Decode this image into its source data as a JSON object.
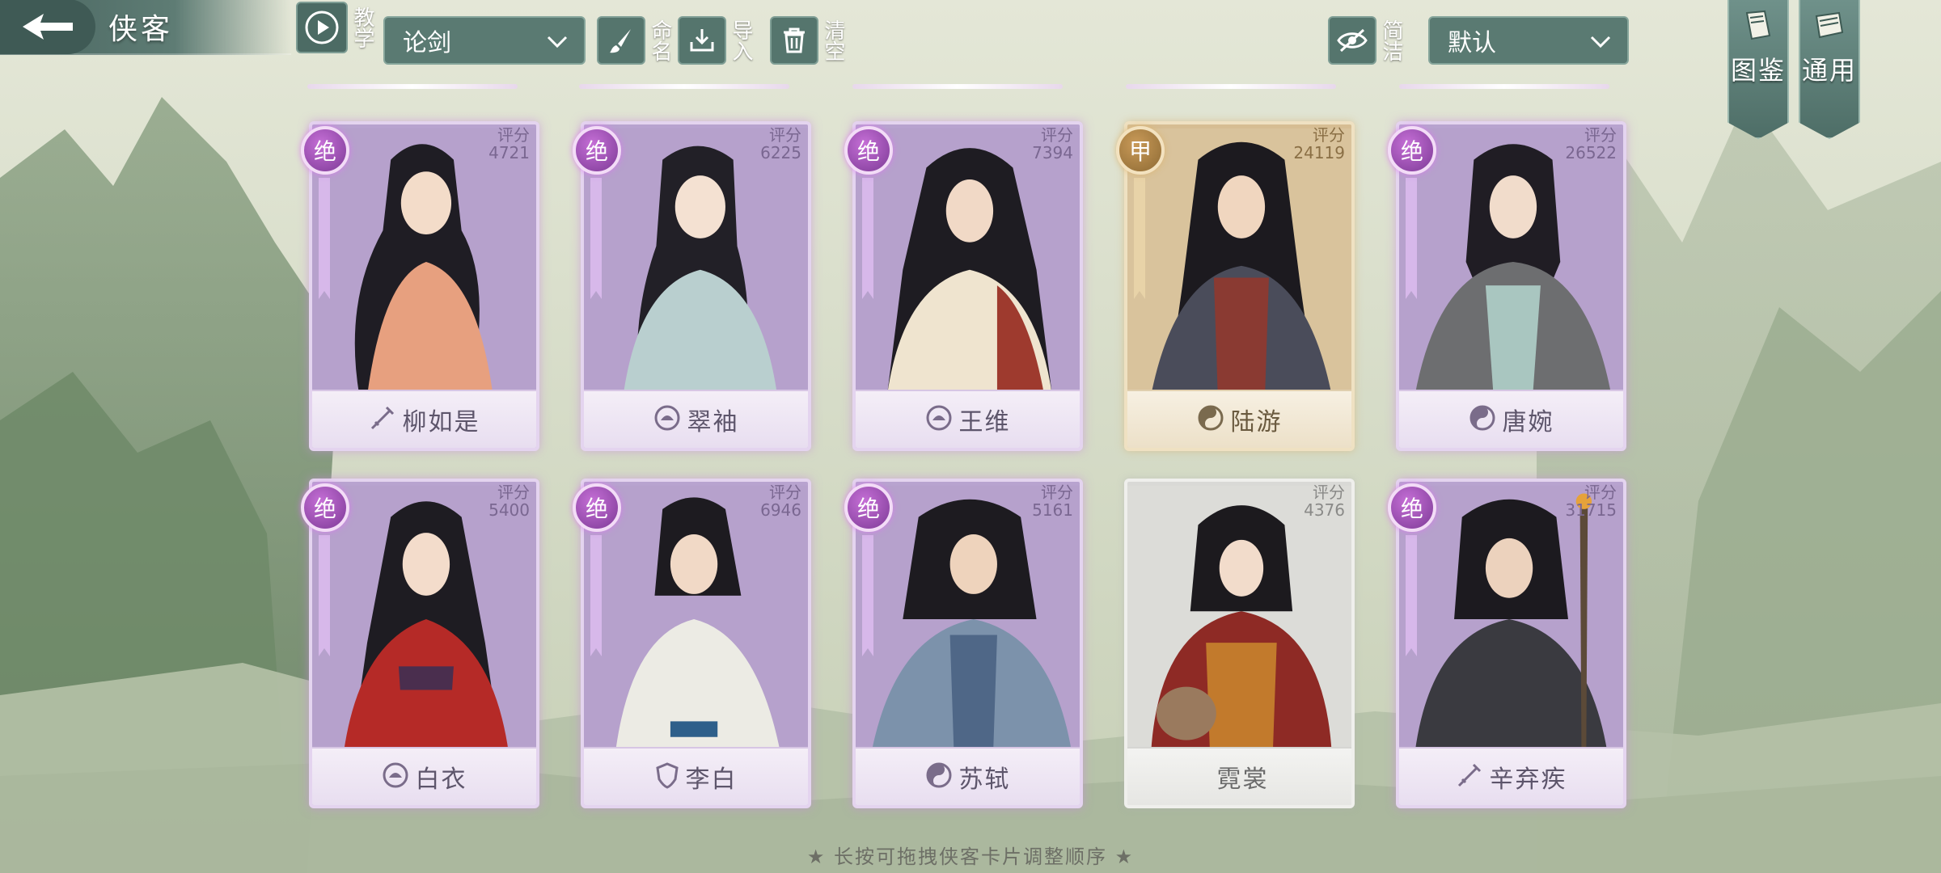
{
  "header": {
    "title": "侠客",
    "teach_label": "教学",
    "mode_select": "论剑",
    "rename_label": "命名",
    "import_label": "导入",
    "clear_label": "清空",
    "simple_label": "简洁",
    "sort_select": "默认",
    "codex_label": "图鉴",
    "general_label": "通用"
  },
  "cards": [
    {
      "name": "柳如是",
      "score_label": "评分",
      "score": "4721",
      "badge": "绝",
      "rarity": "purple",
      "class_icon": "sword-icon"
    },
    {
      "name": "翠袖",
      "score_label": "评分",
      "score": "6225",
      "badge": "绝",
      "rarity": "purple",
      "class_icon": "lotus-icon"
    },
    {
      "name": "王维",
      "score_label": "评分",
      "score": "7394",
      "badge": "绝",
      "rarity": "purple",
      "class_icon": "lotus-icon"
    },
    {
      "name": "陆游",
      "score_label": "评分",
      "score": "24119",
      "badge": "甲",
      "rarity": "gold",
      "class_icon": "taiji-icon"
    },
    {
      "name": "唐婉",
      "score_label": "评分",
      "score": "26522",
      "badge": "绝",
      "rarity": "purple",
      "class_icon": "taiji-icon"
    },
    {
      "name": "白衣",
      "score_label": "评分",
      "score": "5400",
      "badge": "绝",
      "rarity": "purple",
      "class_icon": "lotus-icon"
    },
    {
      "name": "李白",
      "score_label": "评分",
      "score": "6946",
      "badge": "绝",
      "rarity": "purple",
      "class_icon": "shield-icon"
    },
    {
      "name": "苏轼",
      "score_label": "评分",
      "score": "5161",
      "badge": "绝",
      "rarity": "purple",
      "class_icon": "taiji-icon"
    },
    {
      "name": "霓裳",
      "score_label": "评分",
      "score": "4376",
      "badge": "",
      "rarity": "grey",
      "class_icon": ""
    },
    {
      "name": "辛弃疾",
      "score_label": "评分",
      "score": "31715",
      "badge": "绝",
      "rarity": "purple",
      "class_icon": "sword-icon"
    }
  ],
  "footer": {
    "hint": "★ 长按可拖拽侠客卡片调整顺序 ★"
  },
  "colors": {
    "purple_frame": "#b8a3cf",
    "gold_frame": "#d6bd93",
    "grey_frame": "#d9d9d6",
    "toolbar": "#5a7a72"
  }
}
